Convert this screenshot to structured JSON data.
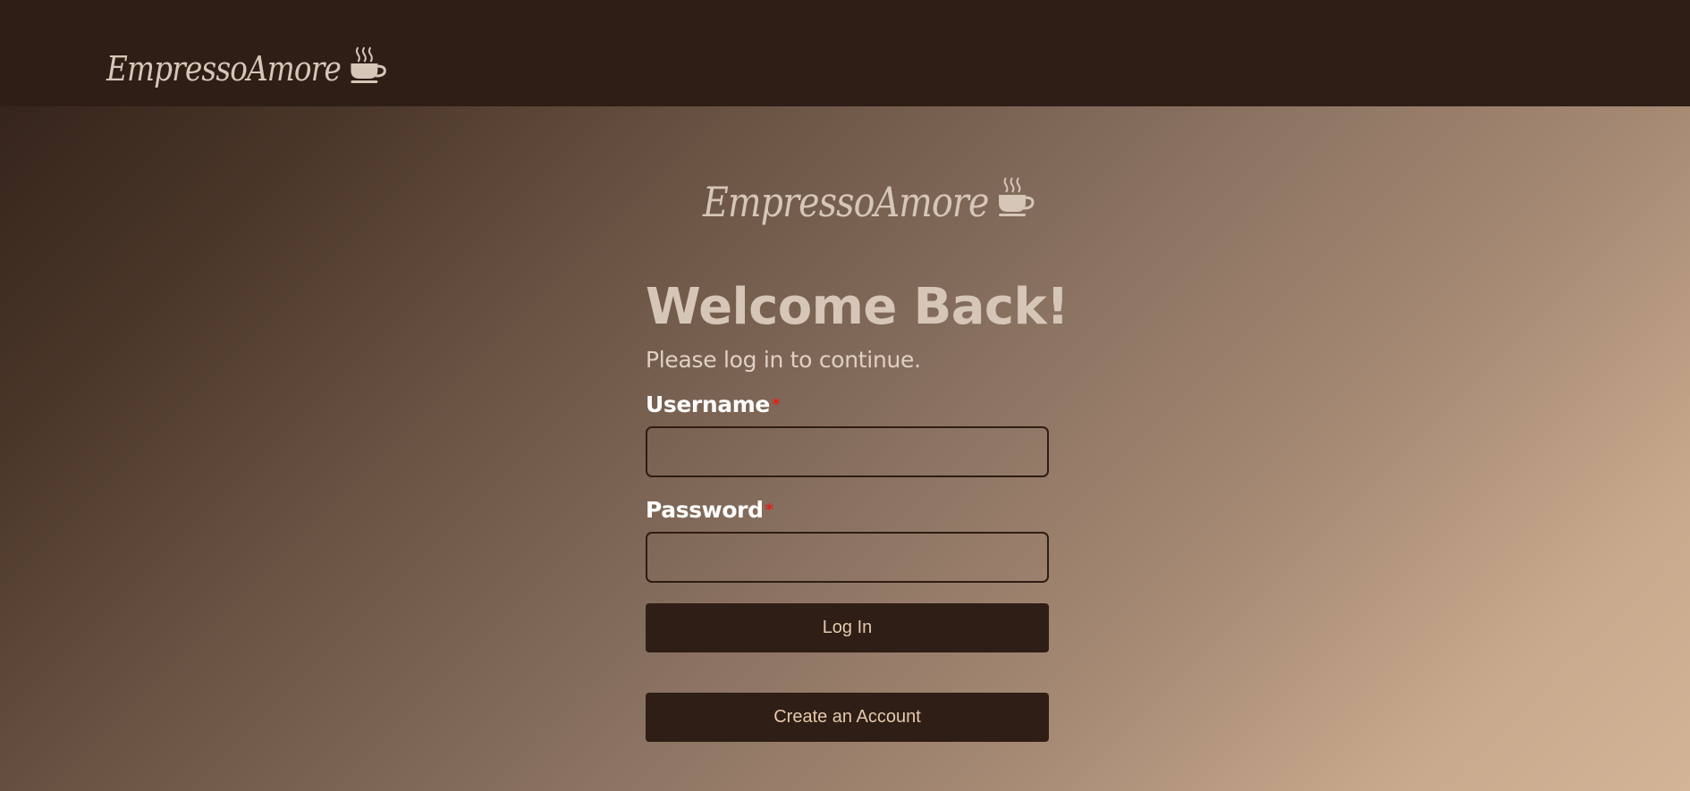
{
  "header": {
    "brand_name": "EmpressoAmore",
    "brand_icon": "coffee-cup-icon"
  },
  "main": {
    "brand_name": "EmpressoAmore",
    "brand_icon": "coffee-cup-icon",
    "title": "Welcome Back!",
    "subtitle": "Please log in to continue.",
    "username_label": "Username",
    "username_required_marker": "*",
    "username_value": "",
    "password_label": "Password",
    "password_required_marker": "*",
    "password_value": "",
    "login_button": "Log In",
    "create_account_button": "Create an Account"
  },
  "colors": {
    "header_bg": "#2f1e16",
    "button_bg": "#2e1e16",
    "button_text": "#e6c9ac",
    "required_marker": "#e0201c",
    "heading_text": "#d6c6b7"
  }
}
